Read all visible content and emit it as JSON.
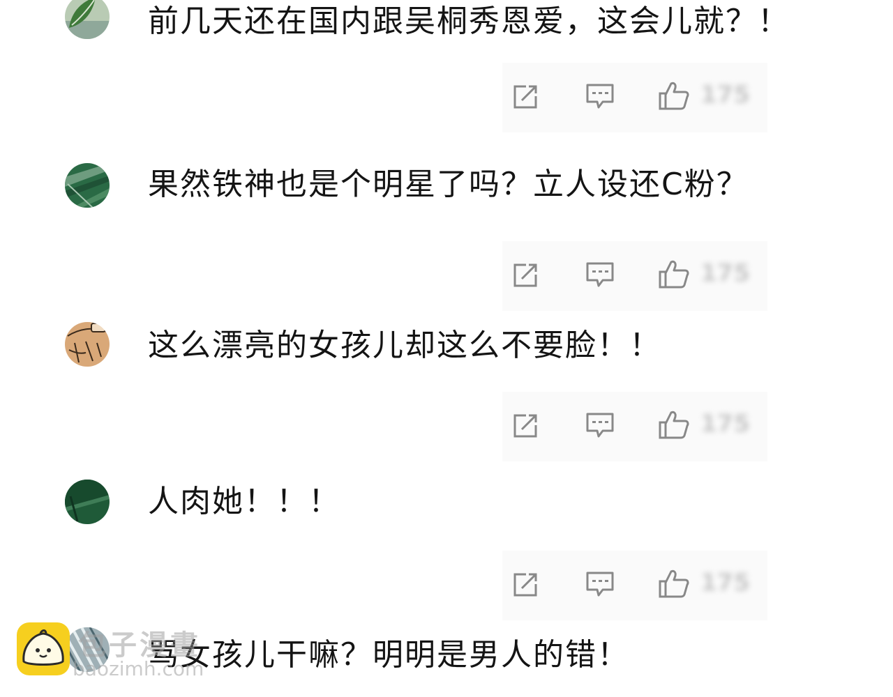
{
  "comments": [
    {
      "avatar_icon": "leaf-avatar-icon",
      "text": "前几天还在国内跟吴桐秀恩爱，这会儿就？！",
      "actions": {
        "share_icon": "share-icon",
        "reply_icon": "comment-icon",
        "like_icon": "thumbs-up-icon",
        "like_count": "175"
      }
    },
    {
      "avatar_icon": "green-stripes-avatar-icon",
      "text": "果然铁神也是个明星了吗？立人设还C粉？",
      "actions": {
        "share_icon": "share-icon",
        "reply_icon": "comment-icon",
        "like_icon": "thumbs-up-icon",
        "like_count": "175"
      }
    },
    {
      "avatar_icon": "sketch-avatar-icon",
      "text": "这么漂亮的女孩儿却这么不要脸！！",
      "actions": {
        "share_icon": "share-icon",
        "reply_icon": "comment-icon",
        "like_icon": "thumbs-up-icon",
        "like_count": "175"
      }
    },
    {
      "avatar_icon": "dark-green-avatar-icon",
      "text": "人肉她！！！",
      "actions": {
        "share_icon": "share-icon",
        "reply_icon": "comment-icon",
        "like_icon": "thumbs-up-icon",
        "like_count": "175"
      }
    },
    {
      "avatar_icon": "striped-avatar-icon",
      "text": "骂女孩儿干嘛？明明是男人的错！"
    }
  ],
  "watermark": {
    "logo_icon": "bun-mascot-icon",
    "title": "包子漫畫",
    "url": "baozimh.com"
  },
  "colors": {
    "text": "#141414",
    "icon": "#888888",
    "action_bar_bg": "#fafafa",
    "logo_yellow": "#f6cf1f"
  }
}
